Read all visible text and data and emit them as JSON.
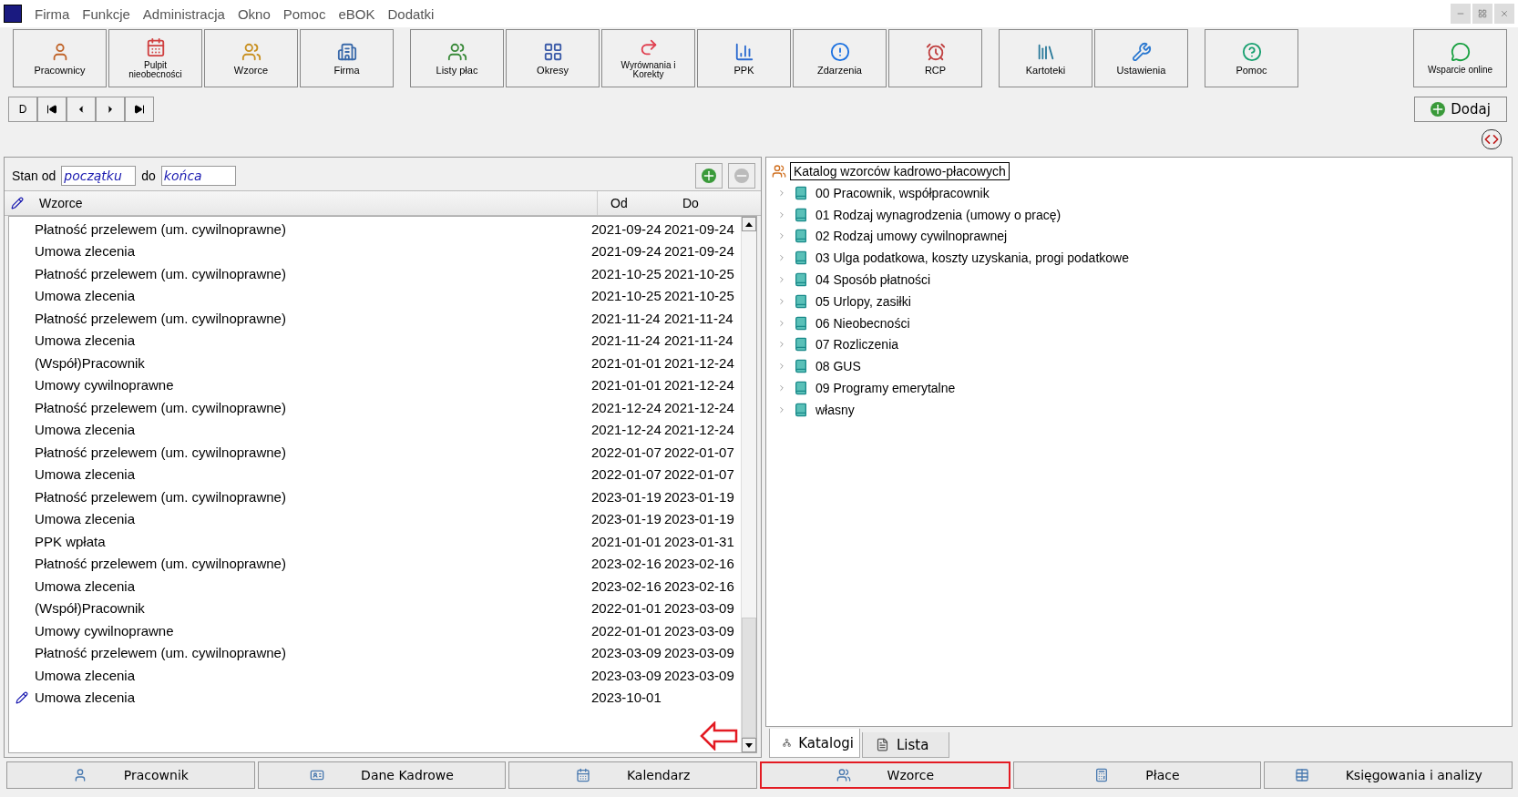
{
  "menu": [
    "Firma",
    "Funkcje",
    "Administracja",
    "Okno",
    "Pomoc",
    "eBOK",
    "Dodatki"
  ],
  "toolbar": [
    [
      {
        "label": "Pracownicy",
        "small": false
      },
      {
        "label": "Pulpit nieobecności",
        "small": true
      },
      {
        "label": "Wzorce",
        "small": false
      },
      {
        "label": "Firma",
        "small": false
      }
    ],
    [
      {
        "label": "Listy płac",
        "small": false
      },
      {
        "label": "Okresy",
        "small": false
      },
      {
        "label": "Wyrównania i Korekty",
        "small": true
      },
      {
        "label": "PPK",
        "small": false
      },
      {
        "label": "Zdarzenia",
        "small": false
      },
      {
        "label": "RCP",
        "small": false
      }
    ],
    [
      {
        "label": "Kartoteki",
        "small": false
      },
      {
        "label": "Ustawienia",
        "small": false
      }
    ],
    [
      {
        "label": "Pomoc",
        "small": false
      }
    ],
    [
      {
        "label": "Wsparcie online",
        "small": true
      }
    ]
  ],
  "nav_buttons": [
    "D"
  ],
  "add_button": "Dodaj",
  "filter": {
    "label": "Stan od",
    "from": "początku",
    "to_label": "do",
    "to": "końca"
  },
  "table": {
    "columns": [
      "Wzorce",
      "Od",
      "Do"
    ],
    "rows": [
      {
        "name": "Płatność przelewem (um. cywilnoprawne)",
        "od": "2021-09-24",
        "do": "2021-09-24",
        "editing": false
      },
      {
        "name": "Umowa zlecenia",
        "od": "2021-09-24",
        "do": "2021-09-24",
        "editing": false
      },
      {
        "name": "Płatność przelewem (um. cywilnoprawne)",
        "od": "2021-10-25",
        "do": "2021-10-25",
        "editing": false
      },
      {
        "name": "Umowa zlecenia",
        "od": "2021-10-25",
        "do": "2021-10-25",
        "editing": false
      },
      {
        "name": "Płatność przelewem (um. cywilnoprawne)",
        "od": "2021-11-24",
        "do": "2021-11-24",
        "editing": false
      },
      {
        "name": "Umowa zlecenia",
        "od": "2021-11-24",
        "do": "2021-11-24",
        "editing": false
      },
      {
        "name": "(Współ)Pracownik",
        "od": "2021-01-01",
        "do": "2021-12-24",
        "editing": false
      },
      {
        "name": "Umowy cywilnoprawne",
        "od": "2021-01-01",
        "do": "2021-12-24",
        "editing": false
      },
      {
        "name": "Płatność przelewem (um. cywilnoprawne)",
        "od": "2021-12-24",
        "do": "2021-12-24",
        "editing": false
      },
      {
        "name": "Umowa zlecenia",
        "od": "2021-12-24",
        "do": "2021-12-24",
        "editing": false
      },
      {
        "name": "Płatność przelewem (um. cywilnoprawne)",
        "od": "2022-01-07",
        "do": "2022-01-07",
        "editing": false
      },
      {
        "name": "Umowa zlecenia",
        "od": "2022-01-07",
        "do": "2022-01-07",
        "editing": false
      },
      {
        "name": "Płatność przelewem (um. cywilnoprawne)",
        "od": "2023-01-19",
        "do": "2023-01-19",
        "editing": false
      },
      {
        "name": "Umowa zlecenia",
        "od": "2023-01-19",
        "do": "2023-01-19",
        "editing": false
      },
      {
        "name": "PPK wpłata",
        "od": "2021-01-01",
        "do": "2023-01-31",
        "editing": false
      },
      {
        "name": "Płatność przelewem (um. cywilnoprawne)",
        "od": "2023-02-16",
        "do": "2023-02-16",
        "editing": false
      },
      {
        "name": "Umowa zlecenia",
        "od": "2023-02-16",
        "do": "2023-02-16",
        "editing": false
      },
      {
        "name": "(Współ)Pracownik",
        "od": "2022-01-01",
        "do": "2023-03-09",
        "editing": false
      },
      {
        "name": "Umowy cywilnoprawne",
        "od": "2022-01-01",
        "do": "2023-03-09",
        "editing": false
      },
      {
        "name": "Płatność przelewem (um. cywilnoprawne)",
        "od": "2023-03-09",
        "do": "2023-03-09",
        "editing": false
      },
      {
        "name": "Umowa zlecenia",
        "od": "2023-03-09",
        "do": "2023-03-09",
        "editing": false
      },
      {
        "name": "Umowa zlecenia",
        "od": "2023-10-01",
        "editing": true
      }
    ]
  },
  "tree": {
    "root": "Katalog wzorców kadrowo-płacowych",
    "items": [
      {
        "label": "00 Pracownik, współpracownik",
        "expanded": false
      },
      {
        "label": "01 Rodzaj wynagrodzenia (umowy o pracę)",
        "expanded": false
      },
      {
        "label": "02 Rodzaj umowy cywilnoprawnej",
        "expanded": false
      },
      {
        "label": "03 Ulga podatkowa, koszty uzyskania, progi podatkowe",
        "expanded": false
      },
      {
        "label": "04 Sposób płatności",
        "expanded": false
      },
      {
        "label": "05 Urlopy, zasiłki",
        "expanded": false
      },
      {
        "label": "06 Nieobecności",
        "expanded": false
      },
      {
        "label": "07 Rozliczenia",
        "expanded": false
      },
      {
        "label": "08 GUS",
        "expanded": false
      },
      {
        "label": "09 Programy emerytalne",
        "expanded": false
      },
      {
        "label": "własny",
        "expanded": false
      }
    ]
  },
  "panel_tabs": [
    {
      "label": "Katalogi",
      "selected": true
    },
    {
      "label": "Lista",
      "selected": false
    }
  ],
  "bottom_tabs": [
    {
      "label": "Pracownik",
      "selected": false
    },
    {
      "label": "Dane Kadrowe",
      "selected": false
    },
    {
      "label": "Kalendarz",
      "selected": false
    },
    {
      "label": "Wzorce",
      "selected": true
    },
    {
      "label": "Płace",
      "selected": false
    },
    {
      "label": "Księgowania i analizy",
      "selected": false
    }
  ]
}
